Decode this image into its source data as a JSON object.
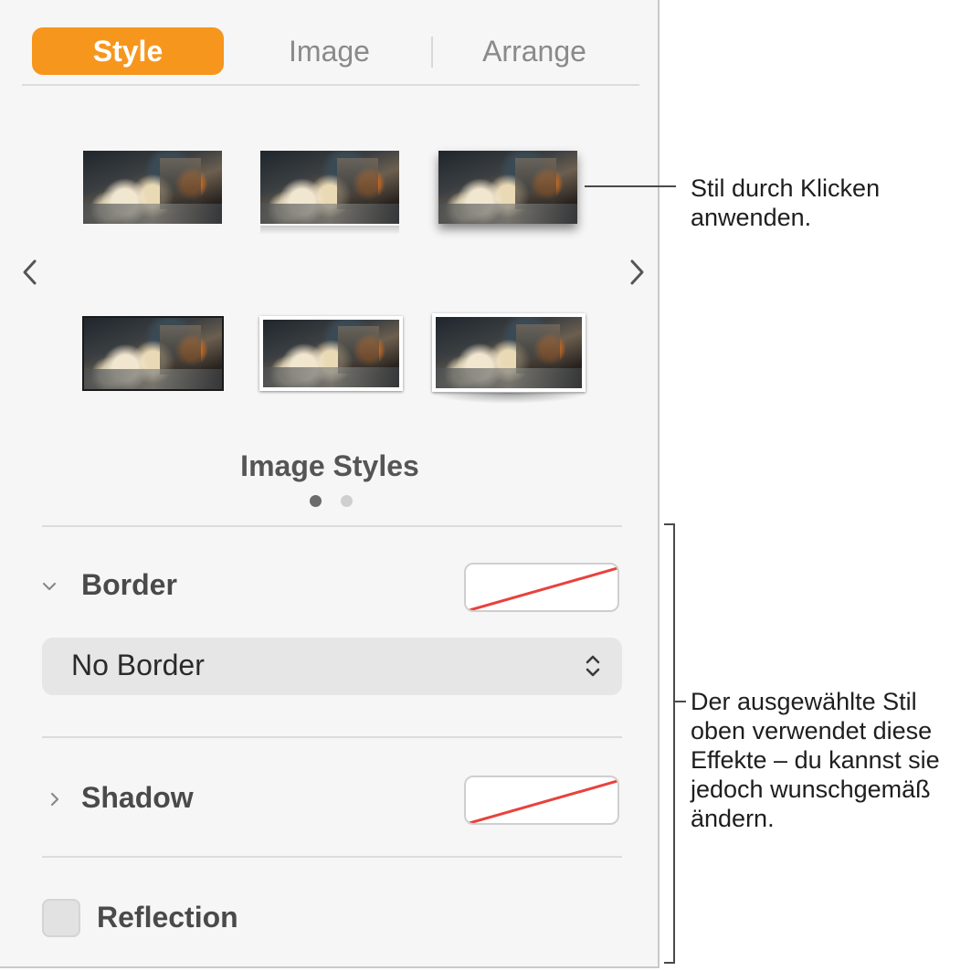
{
  "tabs": [
    {
      "label": "Style",
      "active": true
    },
    {
      "label": "Image",
      "active": false
    },
    {
      "label": "Arrange",
      "active": false
    }
  ],
  "accent_color": "#f7961d",
  "styles_grid": {
    "title": "Image Styles",
    "page": 1,
    "page_count": 2,
    "prev_icon": "chevron-left-icon",
    "next_icon": "chevron-right-icon",
    "thumbnails": [
      {
        "style": "plain"
      },
      {
        "style": "reflection"
      },
      {
        "style": "drop-shadow"
      },
      {
        "style": "black-border"
      },
      {
        "style": "white-border"
      },
      {
        "style": "white-border-curl-shadow"
      }
    ]
  },
  "border": {
    "label": "Border",
    "expanded": true,
    "value": "No Border",
    "swatch": "none"
  },
  "shadow": {
    "label": "Shadow",
    "expanded": false,
    "swatch": "none"
  },
  "reflection": {
    "label": "Reflection",
    "checked": false
  },
  "callouts": {
    "top": "Stil durch Klicken anwenden.",
    "bottom": "Der ausgewählte Stil oben verwendet diese Effekte – du kannst sie jedoch wunschgemäß ändern."
  }
}
